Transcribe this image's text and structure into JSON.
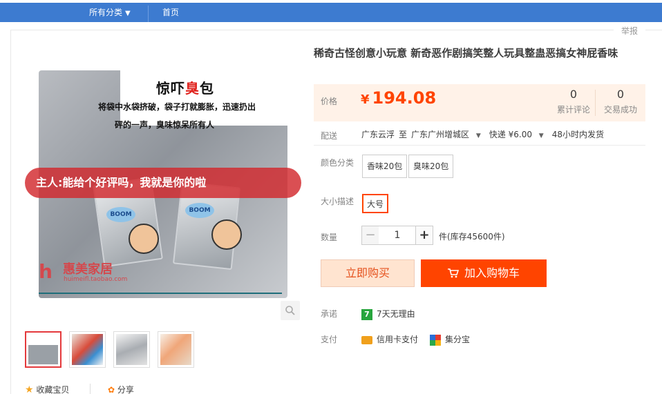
{
  "topnav": {
    "all_categories": "所有分类",
    "caret": "▼",
    "home": "首页"
  },
  "report": "举报",
  "gallery": {
    "image_title_a": "惊吓",
    "image_title_b": "臭",
    "image_title_c": "包",
    "image_line1": "将袋中水袋挤破，袋子打就膨胀，迅速扔出",
    "image_line2": "砰的一声，臭味惊呆所有人",
    "banner": "主人:能给个好评吗，我就是你的啦",
    "boom": "BOOM",
    "watermark_logo": "h",
    "watermark": "惠美家居",
    "watermark_url": "huimeifl.taobao.com"
  },
  "bottom_actions": {
    "favorite": "收藏宝贝",
    "share": "分享"
  },
  "product": {
    "title": "稀奇古怪创意小玩意 新奇恶作剧搞笑整人玩具整蛊恶搞女神屁香味",
    "price_label": "价格",
    "currency": "¥",
    "price": "194.08",
    "reviews_count": "0",
    "reviews_label": "累计评论",
    "sales_count": "0",
    "sales_label": "交易成功"
  },
  "shipping": {
    "label": "配送",
    "from": "广东云浮",
    "to_word": "至",
    "to": "广东广州增城区",
    "express": "快递 ¥6.00",
    "dispatch": "48小时内发货"
  },
  "color": {
    "label": "颜色分类",
    "options": [
      "香味20包",
      "臭味20包"
    ]
  },
  "size": {
    "label": "大小描述",
    "options": [
      "大号"
    ],
    "selected": "大号"
  },
  "quantity": {
    "label": "数量",
    "value": "1",
    "minus": "−",
    "plus": "+",
    "stock": "件(库存45600件)"
  },
  "buttons": {
    "buy_now": "立即购买",
    "add_to_cart": "加入购物车"
  },
  "promise": {
    "label": "承诺",
    "badge": "7",
    "text": "7天无理由"
  },
  "payment": {
    "label": "支付",
    "credit": "信用卡支付",
    "jifenbao": "集分宝"
  },
  "icons": [
    "chevron-down-icon",
    "search-icon",
    "star-icon",
    "share-icon",
    "cart-icon",
    "credit-card-icon",
    "jifenbao-icon",
    "seven-day-icon"
  ],
  "colors": {
    "nav": "#3d7bd0",
    "price": "#ff4400",
    "price_bg": "#fff2e8",
    "add_cart": "#ff4400",
    "buy_now_bg": "#ffe4d0"
  }
}
